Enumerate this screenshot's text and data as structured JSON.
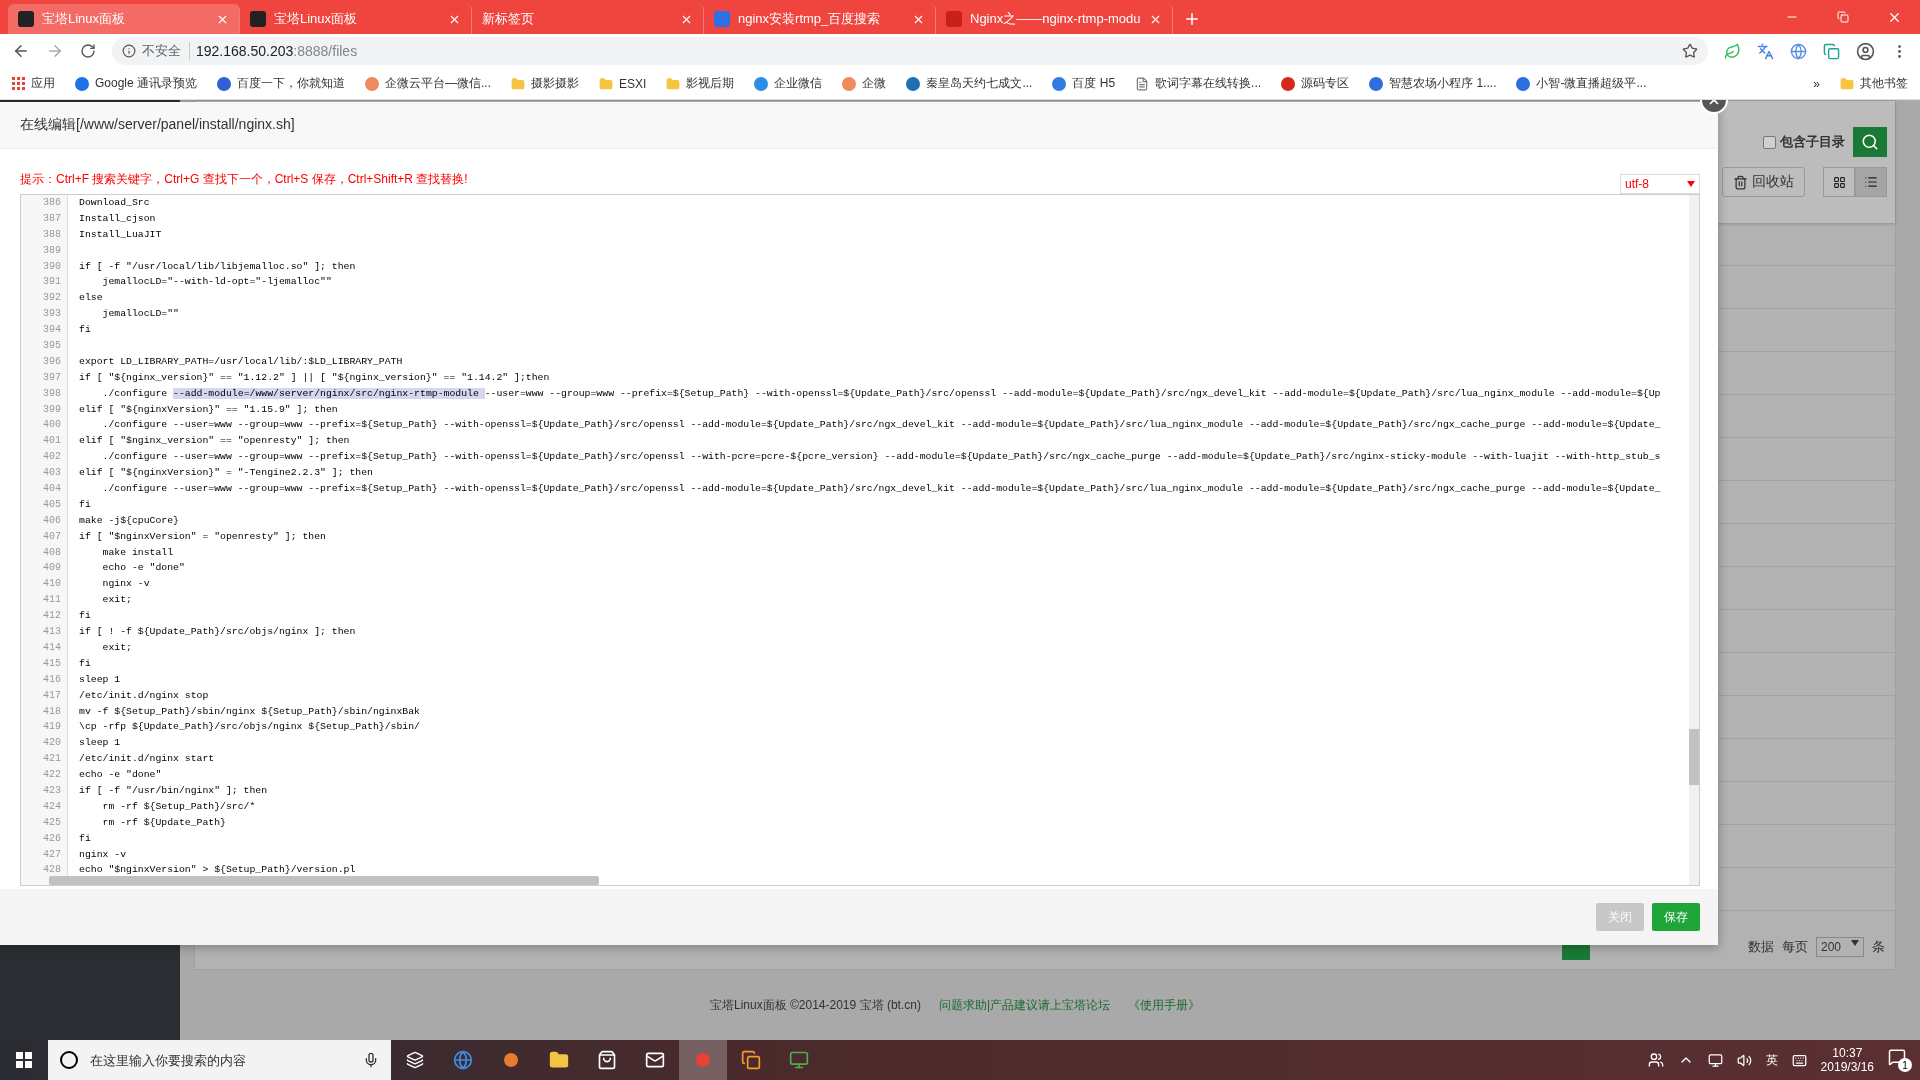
{
  "browser": {
    "tabs": [
      {
        "title": "宝塔Linux面板",
        "selected": true
      },
      {
        "title": "宝塔Linux面板",
        "selected": false
      },
      {
        "title": "新标签页",
        "selected": false
      },
      {
        "title": "nginx安装rtmp_百度搜索",
        "selected": false
      },
      {
        "title": "Nginx之——nginx-rtmp-modu",
        "selected": false
      }
    ],
    "security": "不安全",
    "url_host": "192.168.50.203",
    "url_rest": ":8888/files",
    "bookmarks": [
      {
        "label": "应用",
        "kind": "apps",
        "color": "#e84335"
      },
      {
        "label": "Google 通讯录预览",
        "kind": "site",
        "color": "#1a73e8"
      },
      {
        "label": "百度一下，你就知道",
        "kind": "site",
        "color": "#3060d8"
      },
      {
        "label": "企微云平台—微信...",
        "kind": "site",
        "color": "#f08a5d"
      },
      {
        "label": "摄影摄影",
        "kind": "folder",
        "color": "#f5c542"
      },
      {
        "label": "ESXI",
        "kind": "folder",
        "color": "#f5c542"
      },
      {
        "label": "影视后期",
        "kind": "folder",
        "color": "#f5c542"
      },
      {
        "label": "企业微信",
        "kind": "site",
        "color": "#2b8ee8"
      },
      {
        "label": "企微",
        "kind": "site",
        "color": "#f08a5d"
      },
      {
        "label": "秦皇岛天约七成文...",
        "kind": "site",
        "color": "#1f6fb5"
      },
      {
        "label": "百度 H5",
        "kind": "site",
        "color": "#2f7de1"
      },
      {
        "label": "歌词字幕在线转换...",
        "kind": "page",
        "color": "#777777"
      },
      {
        "label": "源码专区",
        "kind": "site",
        "color": "#d8281e"
      },
      {
        "label": "智慧农场小程序 1....",
        "kind": "site",
        "color": "#2b6fe0"
      },
      {
        "label": "小智-微直播超级平...",
        "kind": "site",
        "color": "#2b6fe0"
      }
    ],
    "more": "»",
    "other_bookmarks": "其他书签"
  },
  "background": {
    "include_subdirs": {
      "label": "包含子目录",
      "checked": false
    },
    "recycle": "回收站",
    "views": [
      {
        "selected": false
      },
      {
        "selected": true
      }
    ],
    "count_label": "数据",
    "per_page": "每页",
    "per_page_value": "200",
    "per_page_unit": "条",
    "footer": {
      "copyright": "宝塔Linux面板 ©2014-2019 宝塔 (bt.cn)",
      "forum": "问题求助|产品建议请上宝塔论坛",
      "manual": "《使用手册》"
    }
  },
  "editor": {
    "title": "在线编辑[/www/server/panel/install/nginx.sh]",
    "hint": "提示：Ctrl+F 搜索关键字，Ctrl+G 查找下一个，Ctrl+S 保存，Ctrl+Shift+R 查找替换!",
    "encoding": "utf-8",
    "lines": [
      {
        "n": "386",
        "parts": [
          {
            "text": "Download_Src",
            "selected": false
          }
        ]
      },
      {
        "n": "387",
        "parts": [
          {
            "text": "Install_cjson",
            "selected": false
          }
        ]
      },
      {
        "n": "388",
        "parts": [
          {
            "text": "Install_LuaJIT",
            "selected": false
          }
        ]
      },
      {
        "n": "389"
      },
      {
        "n": "390",
        "parts": [
          {
            "text": "if [ -f \"/usr/local/lib/libjemalloc.so\" ]; then",
            "selected": false
          }
        ]
      },
      {
        "n": "391",
        "parts": [
          {
            "text": "    jemallocLD=\"--with-ld-opt=\"-ljemalloc\"\"",
            "selected": false
          }
        ]
      },
      {
        "n": "392",
        "parts": [
          {
            "text": "else",
            "selected": false
          }
        ]
      },
      {
        "n": "393",
        "parts": [
          {
            "text": "    jemallocLD=\"\"",
            "selected": false
          }
        ]
      },
      {
        "n": "394",
        "parts": [
          {
            "text": "fi",
            "selected": false
          }
        ]
      },
      {
        "n": "395"
      },
      {
        "n": "396",
        "parts": [
          {
            "text": "export LD_LIBRARY_PATH=/usr/local/lib/:$LD_LIBRARY_PATH",
            "selected": false
          }
        ]
      },
      {
        "n": "397",
        "parts": [
          {
            "text": "if [ \"${nginx_version}\" == \"1.12.2\" ] || [ \"${nginx_version}\" == \"1.14.2\" ];then",
            "selected": false
          }
        ]
      },
      {
        "n": "398",
        "parts": [
          {
            "text": "    ./configure ",
            "selected": false
          },
          {
            "text": "--add-module=/www/server/nginx/src/nginx-rtmp-module ",
            "selected": true
          },
          {
            "text": "--user=www --group=www --prefix=${Setup_Path} --with-openssl=${Update_Path}/src/openssl --add-module=${Update_Path}/src/ngx_devel_kit --add-module=${Update_Path}/src/lua_nginx_module --add-module=${Up",
            "selected": false
          }
        ]
      },
      {
        "n": "399",
        "parts": [
          {
            "text": "elif [ \"${nginxVersion}\" == \"1.15.9\" ]; then",
            "selected": false
          }
        ]
      },
      {
        "n": "400",
        "parts": [
          {
            "text": "    ./configure --user=www --group=www --prefix=${Setup_Path} --with-openssl=${Update_Path}/src/openssl --add-module=${Update_Path}/src/ngx_devel_kit --add-module=${Update_Path}/src/lua_nginx_module --add-module=${Update_Path}/src/ngx_cache_purge --add-module=${Update_",
            "selected": false
          }
        ]
      },
      {
        "n": "401",
        "parts": [
          {
            "text": "elif [ \"$nginx_version\" == \"openresty\" ]; then",
            "selected": false
          }
        ]
      },
      {
        "n": "402",
        "parts": [
          {
            "text": "    ./configure --user=www --group=www --prefix=${Setup_Path} --with-openssl=${Update_Path}/src/openssl --with-pcre=pcre-${pcre_version} --add-module=${Update_Path}/src/ngx_cache_purge --add-module=${Update_Path}/src/nginx-sticky-module --with-luajit --with-http_stub_s",
            "selected": false
          }
        ]
      },
      {
        "n": "403",
        "parts": [
          {
            "text": "elif [ \"${nginxVersion}\" = \"-Tengine2.2.3\" ]; then",
            "selected": false
          }
        ]
      },
      {
        "n": "404",
        "parts": [
          {
            "text": "    ./configure --user=www --group=www --prefix=${Setup_Path} --with-openssl=${Update_Path}/src/openssl --add-module=${Update_Path}/src/ngx_devel_kit --add-module=${Update_Path}/src/lua_nginx_module --add-module=${Update_Path}/src/ngx_cache_purge --add-module=${Update_",
            "selected": false
          }
        ]
      },
      {
        "n": "405",
        "parts": [
          {
            "text": "fi",
            "selected": false
          }
        ]
      },
      {
        "n": "406",
        "parts": [
          {
            "text": "make -j${cpuCore}",
            "selected": false
          }
        ]
      },
      {
        "n": "407",
        "parts": [
          {
            "text": "if [ \"$nginxVersion\" = \"openresty\" ]; then",
            "selected": false
          }
        ]
      },
      {
        "n": "408",
        "parts": [
          {
            "text": "    make install",
            "selected": false
          }
        ]
      },
      {
        "n": "409",
        "parts": [
          {
            "text": "    echo -e \"done\"",
            "selected": false
          }
        ]
      },
      {
        "n": "410",
        "parts": [
          {
            "text": "    nginx -v",
            "selected": false
          }
        ]
      },
      {
        "n": "411",
        "parts": [
          {
            "text": "    exit;",
            "selected": false
          }
        ]
      },
      {
        "n": "412",
        "parts": [
          {
            "text": "fi",
            "selected": false
          }
        ]
      },
      {
        "n": "413",
        "parts": [
          {
            "text": "if [ ! -f ${Update_Path}/src/objs/nginx ]; then",
            "selected": false
          }
        ]
      },
      {
        "n": "414",
        "parts": [
          {
            "text": "    exit;",
            "selected": false
          }
        ]
      },
      {
        "n": "415",
        "parts": [
          {
            "text": "fi",
            "selected": false
          }
        ]
      },
      {
        "n": "416",
        "parts": [
          {
            "text": "sleep 1",
            "selected": false
          }
        ]
      },
      {
        "n": "417",
        "parts": [
          {
            "text": "/etc/init.d/nginx stop",
            "selected": false
          }
        ]
      },
      {
        "n": "418",
        "parts": [
          {
            "text": "mv -f ${Setup_Path}/sbin/nginx ${Setup_Path}/sbin/nginxBak",
            "selected": false
          }
        ]
      },
      {
        "n": "419",
        "parts": [
          {
            "text": "\\cp -rfp ${Update_Path}/src/objs/nginx ${Setup_Path}/sbin/",
            "selected": false
          }
        ]
      },
      {
        "n": "420",
        "parts": [
          {
            "text": "sleep 1",
            "selected": false
          }
        ]
      },
      {
        "n": "421",
        "parts": [
          {
            "text": "/etc/init.d/nginx start",
            "selected": false
          }
        ]
      },
      {
        "n": "422",
        "parts": [
          {
            "text": "echo -e \"done\"",
            "selected": false
          }
        ]
      },
      {
        "n": "423",
        "parts": [
          {
            "text": "if [ -f \"/usr/bin/nginx\" ]; then",
            "selected": false
          }
        ]
      },
      {
        "n": "424",
        "parts": [
          {
            "text": "    rm -rf ${Setup_Path}/src/*",
            "selected": false
          }
        ]
      },
      {
        "n": "425",
        "parts": [
          {
            "text": "    rm -rf ${Update_Path}",
            "selected": false
          }
        ]
      },
      {
        "n": "426",
        "parts": [
          {
            "text": "fi",
            "selected": false
          }
        ]
      },
      {
        "n": "427",
        "parts": [
          {
            "text": "nginx -v",
            "selected": false
          }
        ]
      },
      {
        "n": "428",
        "parts": [
          {
            "text": "echo \"$nginxVersion\" > ${Setup_Path}/version.pl",
            "selected": false
          }
        ]
      }
    ],
    "buttons": [
      {
        "label": "关闭",
        "kind": "secondary"
      },
      {
        "label": "保存",
        "kind": "primary"
      }
    ]
  },
  "taskbar": {
    "search_placeholder": "在这里输入你要搜索的内容",
    "apps": [
      {
        "selected": false
      },
      {
        "selected": false
      },
      {
        "selected": false
      },
      {
        "selected": false
      },
      {
        "selected": false
      },
      {
        "selected": false
      },
      {
        "selected": true
      },
      {
        "selected": false
      },
      {
        "selected": false
      }
    ],
    "ime": "英",
    "time": "10:37",
    "date": "2019/3/16",
    "notifications": "1"
  }
}
